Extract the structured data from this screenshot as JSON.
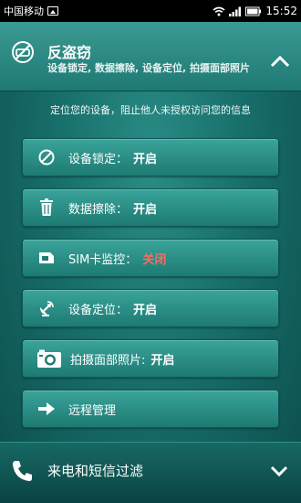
{
  "status_bar": {
    "carrier": "中国移动",
    "time": "15:52",
    "icons": [
      "image-icon",
      "wifi-icon",
      "signal-icon",
      "battery-icon"
    ]
  },
  "section": {
    "title": "反盗窃",
    "subtitle": "设备锁定, 数据擦除, 设备定位, 拍摄面部照片",
    "icon": "anti-theft-icon",
    "expanded": true
  },
  "description": "定位您的设备，阻止他人未授权访问您的信息",
  "buttons": [
    {
      "icon": "block-icon",
      "label": "设备锁定：",
      "value": "开启"
    },
    {
      "icon": "trash-icon",
      "label": "数据擦除：",
      "value": "开启"
    },
    {
      "icon": "sim-icon",
      "label": "SIM卡监控：",
      "value": "关闭"
    },
    {
      "icon": "satellite-icon",
      "label": "设备定位：",
      "value": "开启"
    },
    {
      "icon": "camera-icon",
      "label": "拍摄面部照片:",
      "value": "开启"
    },
    {
      "icon": "arrow-right-icon",
      "label": "远程管理",
      "value": ""
    }
  ],
  "bottom_section": {
    "title": "来电和短信过滤",
    "icon": "phone-icon"
  },
  "colors": {
    "off_value": "#ff6b5e",
    "background": "#0d5856"
  }
}
